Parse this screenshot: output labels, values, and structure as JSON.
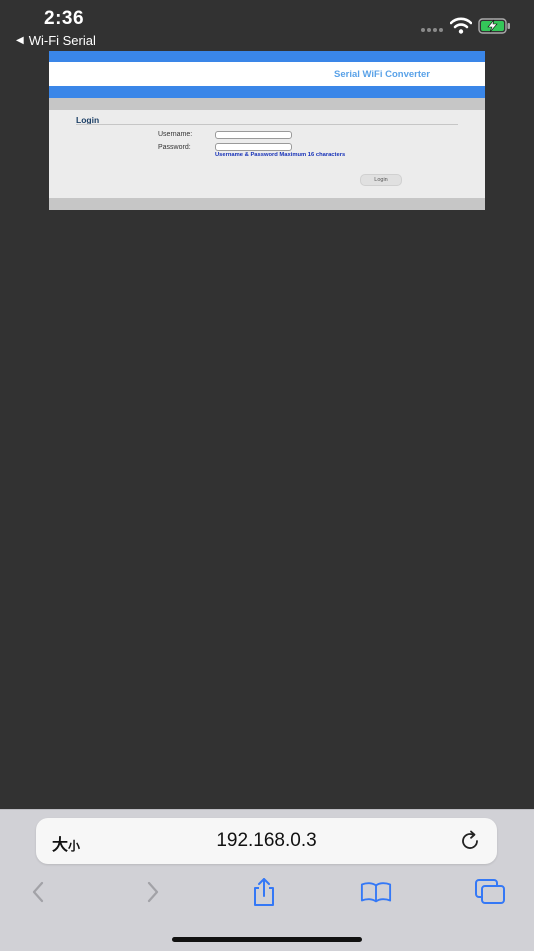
{
  "status_bar": {
    "time": "2:36",
    "back_app": "Wi-Fi Serial",
    "back_glyph": "◀",
    "icons": [
      "signal-icon",
      "wifi-icon",
      "battery-charging-icon"
    ]
  },
  "webpage": {
    "site_title": "Serial WiFi Converter",
    "login_heading": "Login",
    "username_label": "Username:",
    "password_label": "Password:",
    "username_value": "",
    "password_value": "",
    "hint": "Username & Password Maximum 16 characters",
    "login_button": "Login"
  },
  "browser": {
    "text_size_big": "大",
    "text_size_small": "小",
    "url": "192.168.0.3",
    "toolbar_icons": [
      "back-icon",
      "forward-icon",
      "share-icon",
      "bookmarks-icon",
      "tabs-icon"
    ]
  },
  "colors": {
    "page_background": "#323232",
    "header_blue": "#3a86e8",
    "title_blue": "#5aa2e8",
    "hint_blue": "#1732b8",
    "ios_accent": "#3478f6"
  }
}
